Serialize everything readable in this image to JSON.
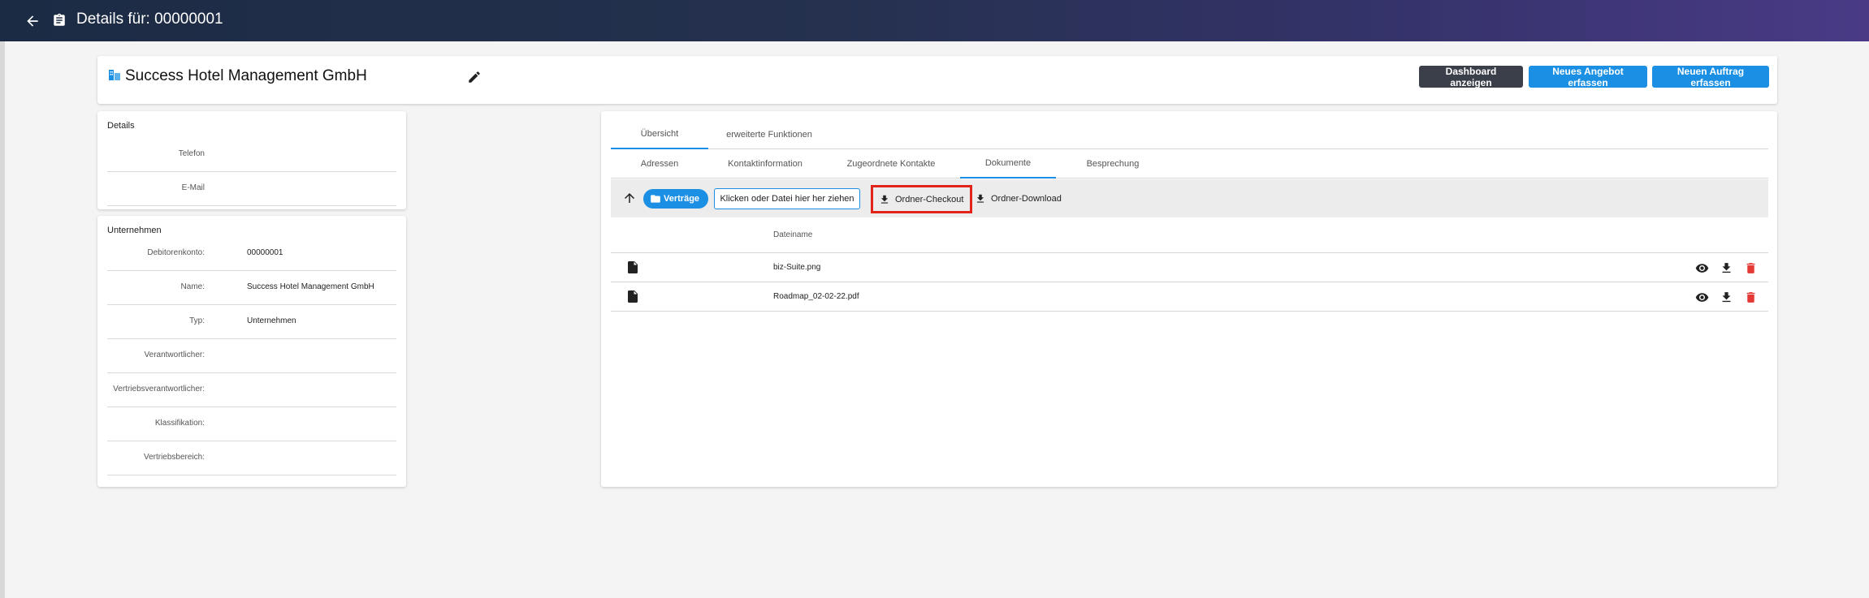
{
  "topbar": {
    "title": "Details für: 00000001",
    "back_icon": "arrow-left-icon",
    "clipboard_icon": "clipboard-icon",
    "colors": {
      "gradient_start": "#1c2b44",
      "gradient_end": "#4a3a86"
    }
  },
  "header": {
    "company_name": "Success Hotel Management GmbH",
    "buttons": {
      "dashboard": "Dashboard anzeigen",
      "new_offer": "Neues Angebot erfassen",
      "new_order": "Neuen Auftrag erfassen"
    },
    "colors": {
      "primary": "#1a8fe3",
      "dark": "#3b3f4a"
    }
  },
  "details": {
    "title": "Details",
    "rows": [
      {
        "label": "Telefon",
        "value": ""
      },
      {
        "label": "E-Mail",
        "value": ""
      }
    ]
  },
  "company": {
    "title": "Unternehmen",
    "rows": [
      {
        "label": "Debitorenkonto:",
        "value": "00000001"
      },
      {
        "label": "Name:",
        "value": "Success Hotel Management GmbH"
      },
      {
        "label": "Typ:",
        "value": "Unternehmen"
      },
      {
        "label": "Verantwortlicher:",
        "value": ""
      },
      {
        "label": "Vertriebsverantwortlicher:",
        "value": ""
      },
      {
        "label": "Klassifikation:",
        "value": ""
      },
      {
        "label": "Vertriebsbereich:",
        "value": ""
      }
    ]
  },
  "main": {
    "top_tabs": [
      "Übersicht",
      "erweiterte Funktionen"
    ],
    "sub_tabs": [
      "Adressen",
      "Kontaktinformation",
      "Zugeordnete Kontakte",
      "Dokumente",
      "Besprechung"
    ],
    "active_top_tab": "Übersicht",
    "active_sub_tab": "Dokumente",
    "toolbar": {
      "folder_chip": "Verträge",
      "dropzone": "Klicken oder Datei hier her ziehen",
      "checkout": "Ordner-Checkout",
      "download": "Ordner-Download"
    },
    "table": {
      "header": "Dateiname",
      "rows": [
        {
          "name": "biz-Suite.png"
        },
        {
          "name": "Roadmap_02-02-22.pdf"
        }
      ]
    },
    "colors": {
      "highlight": "#e2231a",
      "delete": "#e53935"
    }
  }
}
